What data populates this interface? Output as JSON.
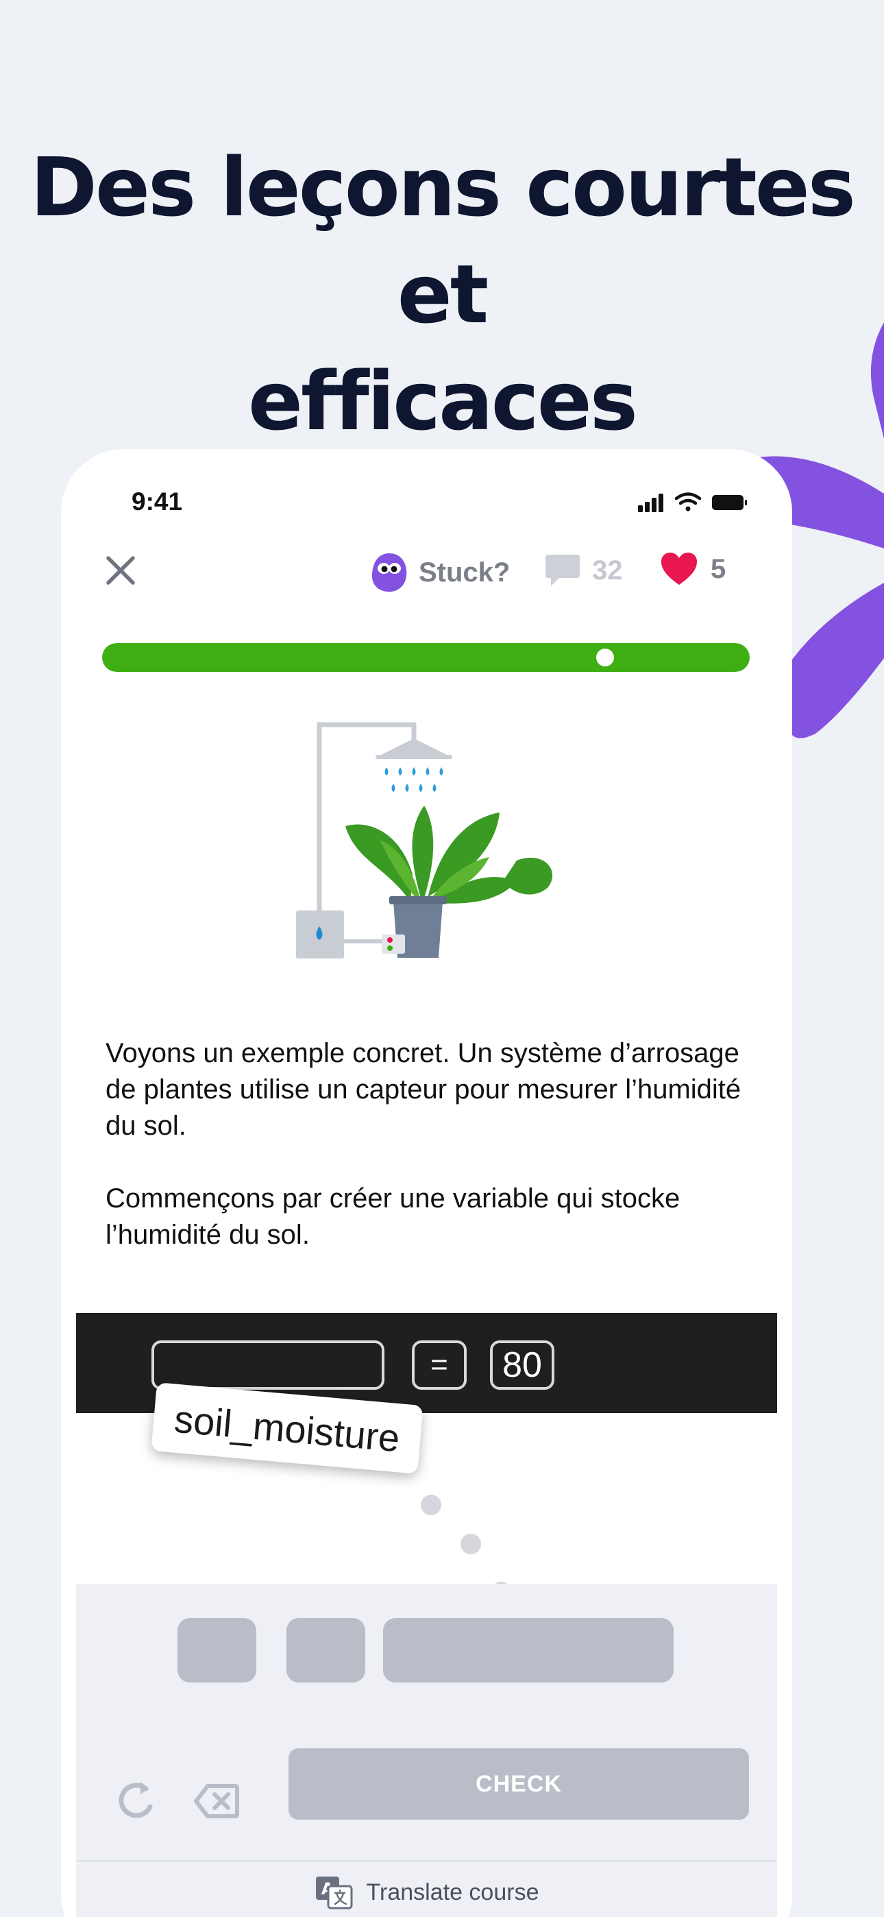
{
  "headline": {
    "line1": "Des leçons courtes et",
    "line2": "efficaces"
  },
  "status_bar": {
    "time": "9:41"
  },
  "lesson_header": {
    "stuck_label": "Stuck?",
    "comments_count": "32",
    "hearts_count": "5",
    "progress_fraction": 0.79
  },
  "lesson": {
    "paragraph1": "Voyons un exemple concret. Un système d’arrosage de plantes utilise un capteur pour mesurer l’humidité du sol.",
    "paragraph2": "Commençons par créer une variable qui stocke l’humidité du sol."
  },
  "code": {
    "equals_token": "=",
    "value_token": "80",
    "dragged_token": "soil_moisture"
  },
  "actions": {
    "check_label": "CHECK",
    "translate_label": "Translate course"
  },
  "colors": {
    "accent_green": "#3fae12",
    "accent_purple": "#8452e0",
    "heart_red": "#e8174f",
    "headline": "#0e1630"
  },
  "icons": [
    "close-icon",
    "stuck-mascot-icon",
    "comment-icon",
    "heart-icon",
    "reset-icon",
    "backspace-icon",
    "translate-icon"
  ]
}
